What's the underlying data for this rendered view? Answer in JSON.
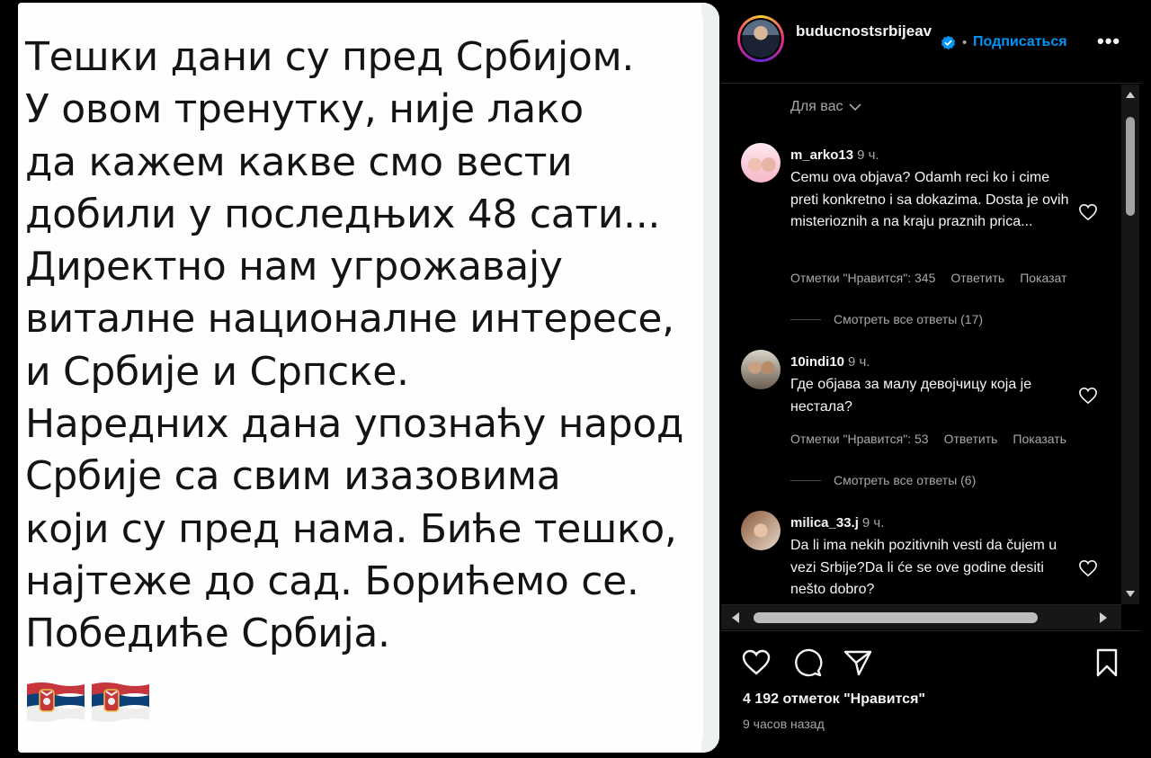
{
  "post": {
    "lines": [
      "Тешки дани су пред Србијом.",
      "У овом тренутку, није лако",
      "да кажем какве смо вести",
      "добили у последњих 48 сати...",
      "Директно нам угрожавају",
      "виталне националне интересе,",
      "и Србије и Српске.",
      "Наредних дана упознаћу народ",
      "Србије са свим изазовима",
      "који су пред нама. Биће тешко,",
      "најтеже до сад. Борићемо се.",
      "Победиће Србија."
    ],
    "flags": [
      "serbia-flag-icon",
      "serbia-flag-icon"
    ]
  },
  "header": {
    "username": "buducnostsrbijeav",
    "separator": "•",
    "follow_label": "Подписаться",
    "more_label": "•••"
  },
  "comments_filter": {
    "label": "Для вас"
  },
  "comments": [
    {
      "user": "m_arko13",
      "time": "9 ч.",
      "text": "Cemu ova objava? Odamh reci ko i cime preti konkretno i sa dokazima. Dosta je ovih misterioznih a na kraju praznih prica...",
      "likes_label": "Отметки \"Нравится\": 345",
      "reply_label": "Ответить",
      "translate_label": "Показат",
      "view_replies": "Смотреть все ответы (17)"
    },
    {
      "user": "10indi10",
      "time": "9 ч.",
      "text": "Где објава за малу девојчицу која је нестала?",
      "likes_label": "Отметки \"Нравится\": 53",
      "reply_label": "Ответить",
      "translate_label": "Показать",
      "view_replies": "Смотреть все ответы (6)"
    },
    {
      "user": "milica_33.j",
      "time": "9 ч.",
      "text": "Da li ima nekih pozitivnih vesti da čujem u vezi Srbije?Da li će se ove godine desiti nešto dobro?"
    }
  ],
  "footer": {
    "likes_count": "4 192 отметок \"Нравится\"",
    "time_ago": "9 часов назад"
  },
  "colors": {
    "accent": "#0095f6",
    "background": "#000000",
    "muted_text": "#a8a8a8"
  }
}
